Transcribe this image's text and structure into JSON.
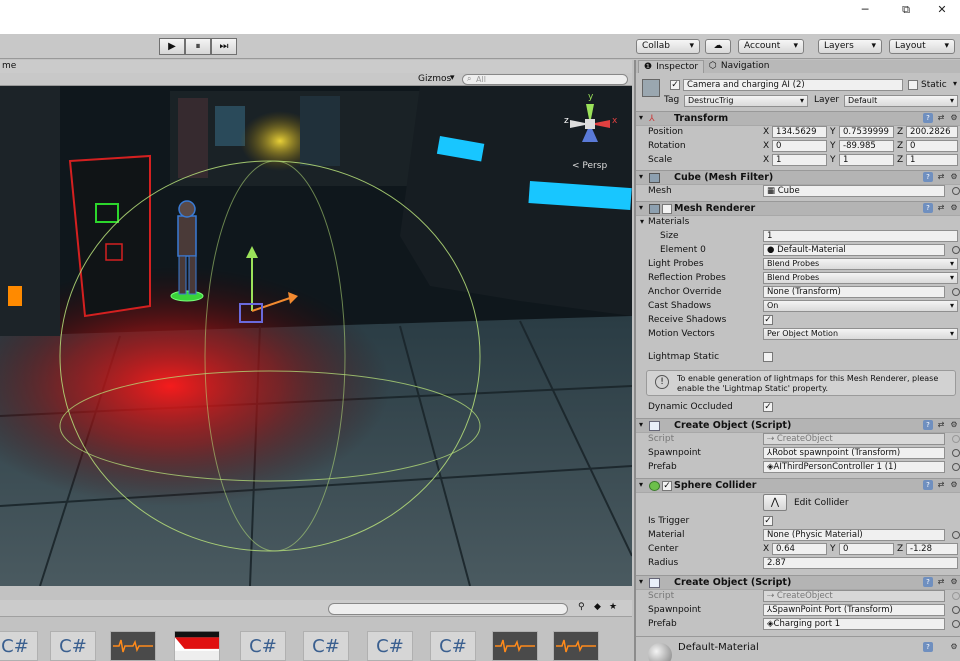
{
  "window": {
    "minimize": "─",
    "maximize": "⧉",
    "close": "✕"
  },
  "toolbar": {
    "play": "▶",
    "pause": "⏸",
    "step": "⏭",
    "collab": "Collab",
    "cloud": "☁",
    "account": "Account",
    "layers": "Layers",
    "layout": "Layout"
  },
  "scene": {
    "tab_fragment": "me",
    "gizmos": "Gizmos",
    "search_placeholder": "All",
    "persp": "Persp",
    "axis_y": "y",
    "axis_x": "x",
    "axis_z": "z"
  },
  "project": {
    "search_placeholder": "",
    "assets": [
      {
        "type": "script",
        "label": "C#"
      },
      {
        "type": "script",
        "label": "C#"
      },
      {
        "type": "audio",
        "label": ""
      },
      {
        "type": "texture",
        "label": ""
      },
      {
        "type": "script",
        "label": "C#"
      },
      {
        "type": "script",
        "label": "C#"
      },
      {
        "type": "script",
        "label": "C#"
      },
      {
        "type": "script",
        "label": "C#"
      },
      {
        "type": "audio",
        "label": ""
      },
      {
        "type": "audio",
        "label": ""
      }
    ]
  },
  "inspector": {
    "tab_inspector": "Inspector",
    "tab_navigation": "Navigation",
    "object_name": "Camera and charging AI (2)",
    "static_label": "Static",
    "tag_label": "Tag",
    "tag_value": "DestrucTrig",
    "layer_label": "Layer",
    "layer_value": "Default",
    "transform": {
      "title": "Transform",
      "position_label": "Position",
      "rotation_label": "Rotation",
      "scale_label": "Scale",
      "position": {
        "x": "134.5629",
        "y": "0.7539999",
        "z": "200.2826"
      },
      "rotation": {
        "x": "0",
        "y": "-89.985",
        "z": "0"
      },
      "scale": {
        "x": "1",
        "y": "1",
        "z": "1"
      }
    },
    "mesh_filter": {
      "title": "Cube (Mesh Filter)",
      "mesh_label": "Mesh",
      "mesh_value": "Cube"
    },
    "mesh_renderer": {
      "title": "Mesh Renderer",
      "materials_label": "Materials",
      "size_label": "Size",
      "size_value": "1",
      "element0_label": "Element 0",
      "element0_value": "Default-Material",
      "light_probes_label": "Light Probes",
      "light_probes_value": "Blend Probes",
      "reflection_probes_label": "Reflection Probes",
      "reflection_probes_value": "Blend Probes",
      "anchor_label": "Anchor Override",
      "anchor_value": "None (Transform)",
      "cast_label": "Cast Shadows",
      "cast_value": "On",
      "receive_label": "Receive Shadows",
      "motion_label": "Motion Vectors",
      "motion_value": "Per Object Motion",
      "lightmap_label": "Lightmap Static",
      "info": "To enable generation of lightmaps for this Mesh Renderer, please enable the 'Lightmap Static' property.",
      "dynamic_label": "Dynamic Occluded"
    },
    "create_object_1": {
      "title": "Create Object (Script)",
      "script_label": "Script",
      "script_value": "CreateObject",
      "spawn_label": "Spawnpoint",
      "spawn_value": "Robot spawnpoint (Transform)",
      "prefab_label": "Prefab",
      "prefab_value": "AIThirdPersonController 1 (1)"
    },
    "sphere_collider": {
      "title": "Sphere Collider",
      "edit_label": "Edit Collider",
      "trigger_label": "Is Trigger",
      "material_label": "Material",
      "material_value": "None (Physic Material)",
      "center_label": "Center",
      "center": {
        "x": "0.64",
        "y": "0",
        "z": "-1.28"
      },
      "radius_label": "Radius",
      "radius_value": "2.87"
    },
    "create_object_2": {
      "title": "Create Object (Script)",
      "script_label": "Script",
      "script_value": "CreateObject",
      "spawn_label": "Spawnpoint",
      "spawn_value": "SpawnPoint Port (Transform)",
      "prefab_label": "Prefab",
      "prefab_value": "Charging port 1"
    },
    "material_title": "Default-Material",
    "xyz": {
      "x": "X",
      "y": "Y",
      "z": "Z"
    }
  }
}
